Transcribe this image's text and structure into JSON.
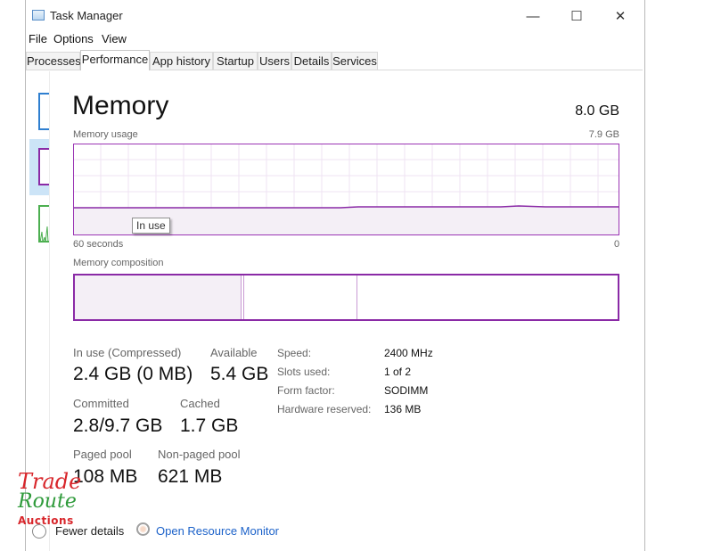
{
  "window": {
    "title": "Task Manager",
    "minimize": "—",
    "maximize": "☐",
    "close": "✕"
  },
  "menu": [
    {
      "label": "File"
    },
    {
      "label": "Options"
    },
    {
      "label": "View"
    }
  ],
  "tabs": [
    {
      "label": "Processes"
    },
    {
      "label": "Performance"
    },
    {
      "label": "App history"
    },
    {
      "label": "Startup"
    },
    {
      "label": "Users"
    },
    {
      "label": "Details"
    },
    {
      "label": "Services"
    }
  ],
  "main": {
    "heading": "Memory",
    "capacity": "8.0 GB",
    "usage_label": "Memory usage",
    "usage_max": "7.9 GB",
    "time_left": "60 seconds",
    "time_right": "0",
    "tooltip": "In use",
    "composition_label": "Memory composition"
  },
  "stats": {
    "in_use_label": "In use (Compressed)",
    "in_use_value": "2.4 GB (0 MB)",
    "available_label": "Available",
    "available_value": "5.4 GB",
    "committed_label": "Committed",
    "committed_value": "2.8/9.7 GB",
    "cached_label": "Cached",
    "cached_value": "1.7 GB",
    "paged_label": "Paged pool",
    "paged_value": "108 MB",
    "nonpaged_label": "Non-paged pool",
    "nonpaged_value": "621 MB"
  },
  "properties": [
    {
      "label": "Speed:",
      "value": "2400 MHz"
    },
    {
      "label": "Slots used:",
      "value": "1 of 2"
    },
    {
      "label": "Form factor:",
      "value": "SODIMM"
    },
    {
      "label": "Hardware reserved:",
      "value": "136 MB"
    }
  ],
  "footer": {
    "fewer_details": "Fewer details",
    "resource_monitor": "Open Resource Monitor"
  },
  "watermark": {
    "line1": "Trade",
    "line2": "Route",
    "line3": "Auctions"
  },
  "colors": {
    "accent": "#8a2aa6",
    "graph_fill": "#f4eff6",
    "link": "#1c62c9"
  }
}
